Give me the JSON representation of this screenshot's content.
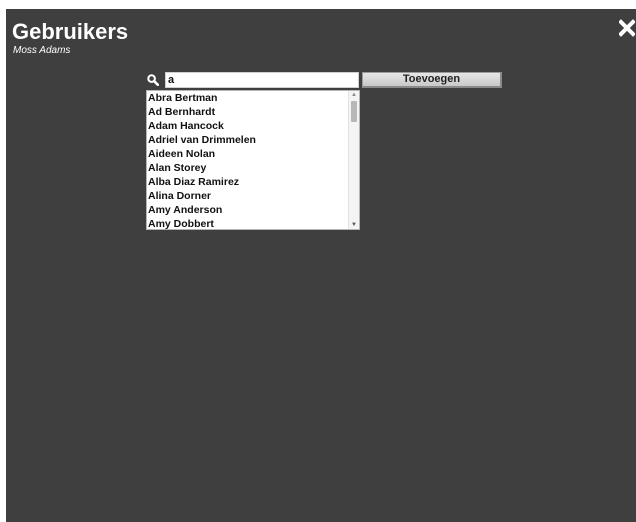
{
  "header": {
    "title": "Gebruikers",
    "subtitle": "Moss Adams"
  },
  "search": {
    "value": "a",
    "add_label": "Toevoegen"
  },
  "suggestions": [
    "Abra Bertman",
    "Ad Bernhardt",
    "Adam Hancock",
    "Adriel van Drimmelen",
    "Aideen Nolan",
    "Alan Storey",
    "Alba Diaz Ramirez",
    "Alina Dorner",
    "Amy Anderson",
    "Amy Dobbert"
  ],
  "scrollbar": {
    "position": 0.05
  },
  "icons": {
    "close": "close-icon",
    "search": "search-icon",
    "scroll_up": "scroll-up-arrow-icon",
    "scroll_down": "scroll-down-arrow-icon"
  },
  "colors": {
    "panel_background": "#3f3f3f",
    "text_on_panel": "#ffffff"
  }
}
